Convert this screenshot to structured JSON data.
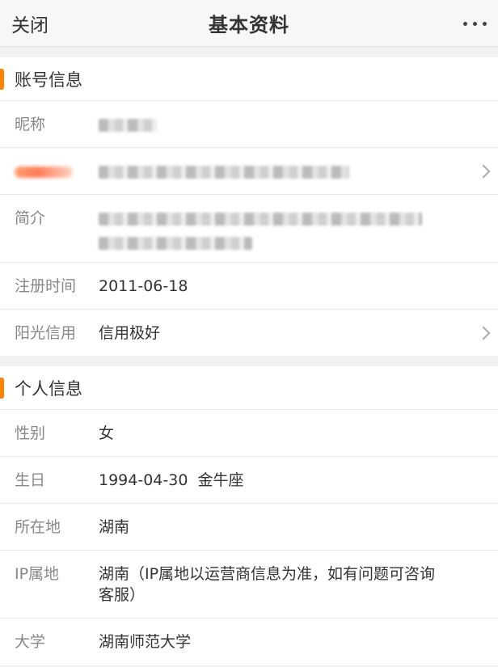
{
  "navbar": {
    "close_label": "关闭",
    "title": "基本资料",
    "more_icon": "more-dots-icon"
  },
  "account_section": {
    "title": "账号信息",
    "rows": {
      "nickname_label": "昵称",
      "intro_label": "简介",
      "register_label": "注册时间",
      "register_value": "2011-06-18",
      "credit_label": "阳光信用",
      "credit_value": "信用极好"
    }
  },
  "personal_section": {
    "title": "个人信息",
    "rows": {
      "gender_label": "性别",
      "gender_value": "女",
      "birthday_label": "生日",
      "birthday_value": "1994-04-30  金牛座",
      "location_label": "所在地",
      "location_value": "湖南",
      "ip_label": "IP属地",
      "ip_value": "湖南（IP属地以运营商信息为准，如有问题可咨询客服）",
      "university_label": "大学",
      "university_value": "湖南师范大学"
    }
  },
  "colors": {
    "accent": "#ff8200",
    "label": "#888888",
    "text": "#333333"
  }
}
